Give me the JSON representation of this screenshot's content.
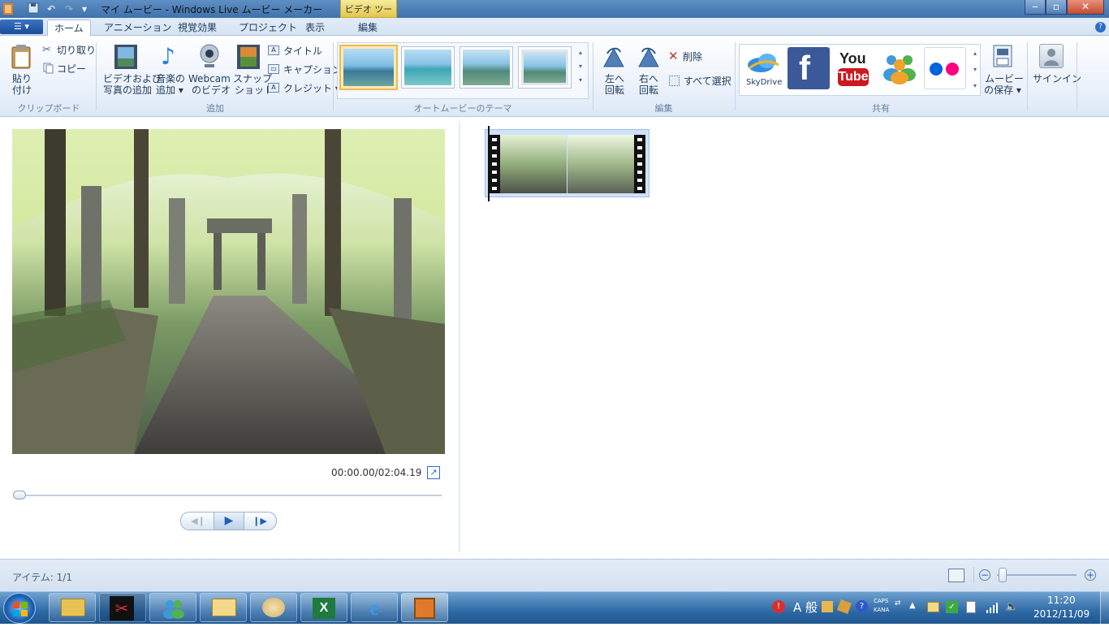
{
  "window": {
    "title": "マイ ムービー - Windows Live ムービー メーカー",
    "contextual_tab": "ビデオ ツール"
  },
  "tabs": [
    {
      "label": "ホーム"
    },
    {
      "label": "アニメーション"
    },
    {
      "label": "視覚効果"
    },
    {
      "label": "プロジェクト"
    },
    {
      "label": "表示"
    },
    {
      "label": "編集"
    }
  ],
  "ribbon": {
    "clipboard": {
      "label": "クリップボード",
      "paste_line1": "貼り",
      "paste_line2": "付け",
      "cut": "切り取り",
      "copy": "コピー"
    },
    "add": {
      "label": "追加",
      "video_line1": "ビデオおよび",
      "video_line2": "写真の追加",
      "music_line1": "音楽の",
      "music_line2": "追加 ▾",
      "webcam_line1": "Webcam",
      "webcam_line2": "のビデオ",
      "snapshot_line1": "スナップ",
      "snapshot_line2": "ショット",
      "title": "タイトル",
      "caption": "キャプション",
      "credit": "クレジット ▾"
    },
    "themes": {
      "label": "オートムービーのテーマ"
    },
    "edit": {
      "label": "編集",
      "rotate_left_line1": "左へ",
      "rotate_left_line2": "回転",
      "rotate_right_line1": "右へ",
      "rotate_right_line2": "回転",
      "delete": "削除",
      "select_all": "すべて選択"
    },
    "share": {
      "label": "共有",
      "skydrive": "SkyDrive",
      "youtube_line1": "You",
      "youtube_line2": "Tube",
      "save_movie_line1": "ムービー",
      "save_movie_line2": "の保存 ▾"
    },
    "signin": "サインイン"
  },
  "preview": {
    "timecode": "00:00.00/02:04.19",
    "playback_progress": 0
  },
  "status": {
    "items": "アイテム: 1/1"
  },
  "taskbar": {
    "ime_mode": "A 般",
    "caps": "CAPS",
    "kana": "KANA",
    "time": "11:20",
    "date": "2012/11/09"
  },
  "colors": {
    "accent": "#2c6ec8",
    "selected_theme_border": "#f0b84a",
    "close_button": "#c44a30",
    "facebook": "#3b5998",
    "youtube_red": "#cc181e",
    "flickr_blue": "#0063dc",
    "flickr_pink": "#ff0084"
  }
}
